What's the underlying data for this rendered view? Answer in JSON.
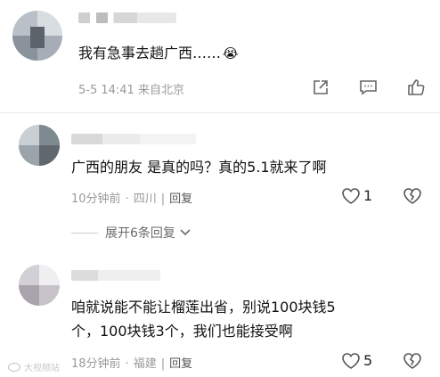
{
  "comment1": {
    "text": "我有急事去趟广西……",
    "emoji": "😭",
    "meta": "5-5 14:41 来自北京",
    "actions": [
      "share-icon",
      "comment-icon",
      "like-icon"
    ]
  },
  "comment2": {
    "text": "广西的朋友 是真的吗？真的5.1就来了啊",
    "time": "10分钟前",
    "location": "四川",
    "reply_label": "回复",
    "like_count": "1",
    "dislike_icon": "broken-heart-icon"
  },
  "expand": {
    "label": "展开6条回复"
  },
  "comment3": {
    "text_line1": "咱就说能不能让榴莲出省，别说100块钱5",
    "text_line2": "个，100块钱3个，我们也能接受啊",
    "time": "18分钟前",
    "location": "福建",
    "reply_label": "回复",
    "like_count": "5",
    "dislike_icon": "broken-heart-icon"
  },
  "watermark": {
    "text": "大视频站"
  },
  "colors": {
    "meta_gray": "#9a9a9a",
    "icon_gray": "#666666",
    "divider": "#ececec"
  }
}
